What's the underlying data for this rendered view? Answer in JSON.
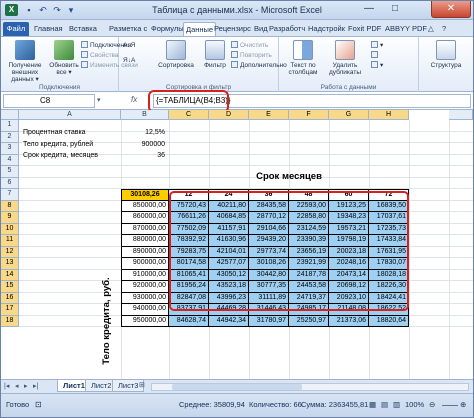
{
  "window": {
    "title": "Таблица с данными.xlsx - Microsoft Excel",
    "app_icon": "excel-icon",
    "controls": [
      "—",
      "□",
      "✕"
    ]
  },
  "ribbon_tabs": [
    "Файл",
    "Главная",
    "Вставка",
    "Разметка с",
    "Формулы",
    "Данные",
    "Рецензирс",
    "Вид",
    "Разработч",
    "Надстройк",
    "Foxit PDF",
    "ABBYY PDF"
  ],
  "ribbon": {
    "get_external": "Получение внешних данных ▾",
    "refresh_all": "Обновить все ▾",
    "connections": "Подключения",
    "properties": "Свойства",
    "edit_links": "Изменить связи",
    "connections_group": "Подключения",
    "sort_az": "А↓Я",
    "sort_za": "Я↓А",
    "sort": "Сортировка",
    "filter": "Фильтр",
    "clear": "Очистить",
    "reapply": "Повторить",
    "advanced": "Дополнительно",
    "sort_filter_group": "Сортировка и фильтр",
    "text_to_columns": "Текст по столбцам",
    "remove_dup": "Удалить дубликаты",
    "data_tools_group": "Работа с данными",
    "outline": "Структура"
  },
  "formula_bar": {
    "name_box": "C8",
    "fx": "fx",
    "formula": "{=ТАБЛИЦА(B4;B3)}"
  },
  "columns": [
    "A",
    "B",
    "C",
    "D",
    "E",
    "F",
    "G",
    "H"
  ],
  "rows": [
    "1",
    "2",
    "3",
    "4",
    "5",
    "6",
    "7",
    "8",
    "9",
    "10",
    "11",
    "12",
    "13",
    "14",
    "15",
    "16",
    "17",
    "18"
  ],
  "params": [
    {
      "label": "Процентная ставка",
      "value": "12,5%"
    },
    {
      "label": "Тело кредита, рублей",
      "value": "900000"
    },
    {
      "label": "Срок кредита, месяцев",
      "value": "36"
    }
  ],
  "table": {
    "title": "Срок месяцев",
    "row_label": "Тело кредита, руб.",
    "corner": "30108,26",
    "months": [
      "12",
      "24",
      "36",
      "48",
      "60",
      "72"
    ],
    "bodies": [
      "850000,00",
      "860000,00",
      "870000,00",
      "880000,00",
      "890000,00",
      "900000,00",
      "910000,00",
      "920000,00",
      "930000,00",
      "940000,00",
      "950000,00"
    ],
    "results": [
      [
        "75720,43",
        "40211,80",
        "28435,58",
        "22593,00",
        "19123,25",
        "16839,50"
      ],
      [
        "76611,26",
        "40684,85",
        "28770,12",
        "22858,80",
        "19348,23",
        "17037,61"
      ],
      [
        "77502,09",
        "41157,91",
        "29104,66",
        "23124,59",
        "19573,21",
        "17235,73"
      ],
      [
        "78392,92",
        "41630,96",
        "29439,20",
        "23390,39",
        "19798,19",
        "17433,84"
      ],
      [
        "79283,75",
        "42104,01",
        "29773,74",
        "23656,19",
        "20023,18",
        "17631,95"
      ],
      [
        "80174,58",
        "42577,07",
        "30108,26",
        "23921,99",
        "20248,16",
        "17830,07"
      ],
      [
        "81065,41",
        "43050,12",
        "30442,80",
        "24187,78",
        "20473,14",
        "18028,18"
      ],
      [
        "81956,24",
        "43523,18",
        "30777,35",
        "24453,58",
        "20698,12",
        "18226,30"
      ],
      [
        "82847,08",
        "43996,23",
        "31111,89",
        "24719,37",
        "20923,10",
        "18424,41"
      ],
      [
        "83737,91",
        "44469,28",
        "31446,43",
        "24985,17",
        "21148,08",
        "18622,52"
      ],
      [
        "84628,74",
        "44942,34",
        "31780,97",
        "25250,97",
        "21373,06",
        "18820,64"
      ]
    ]
  },
  "sheets": [
    "Лист1",
    "Лист2",
    "Лист3"
  ],
  "status": {
    "ready": "Готово",
    "average": "Среднее: 35809,94",
    "count": "Количество: 66",
    "sum": "Сумма: 2363455,81",
    "zoom": "100%"
  }
}
